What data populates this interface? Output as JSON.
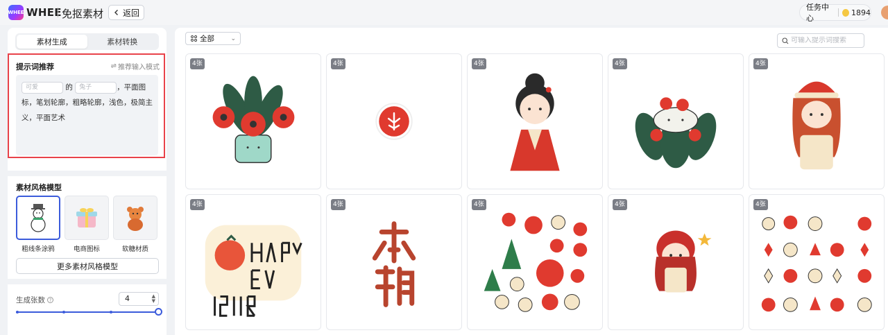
{
  "header": {
    "logo_text": "WHEE",
    "brand": "WHEE",
    "page_name": "免抠素材",
    "back_label": "返回",
    "task_center": "任务中心",
    "credits": "1894"
  },
  "sidebar": {
    "tabs": [
      {
        "label": "素材生成",
        "active": true
      },
      {
        "label": "素材转换",
        "active": false
      }
    ],
    "prompt": {
      "title": "提示词推荐",
      "switch_label": "推荐输入模式",
      "slot1_placeholder": "可爱",
      "connector": "的",
      "slot2_placeholder": "兔子",
      "text": "，平面图标，笔划轮廓，粗略轮廓，浅色，极简主义，平面艺术"
    },
    "styles": {
      "title": "素材风格模型",
      "items": [
        {
          "name": "粗线条涂鸦",
          "selected": true,
          "icon": "snowman-icon"
        },
        {
          "name": "电商图标",
          "selected": false,
          "icon": "gift-box-icon"
        },
        {
          "name": "软糖材质",
          "selected": false,
          "icon": "gummy-bear-icon"
        }
      ],
      "more_label": "更多素材风格模型"
    },
    "count": {
      "label": "生成张数",
      "value": "4"
    }
  },
  "main": {
    "filter_label": "全部",
    "search_placeholder": "可输入提示词搜索",
    "cells": [
      {
        "badge": "4张",
        "art": "flower-pot"
      },
      {
        "badge": "4张",
        "art": "red-circle-icon"
      },
      {
        "badge": "4张",
        "art": "hanfu-girl"
      },
      {
        "badge": "4张",
        "art": "rice-ball-leaves"
      },
      {
        "badge": "4张",
        "art": "christmas-girl"
      },
      {
        "badge": "4张",
        "art": "happy-new-year-text"
      },
      {
        "badge": "4张",
        "art": "calligraphy"
      },
      {
        "badge": "4张",
        "art": "christmas-stickers"
      },
      {
        "badge": "4张",
        "art": "red-dress-girl"
      },
      {
        "badge": "4张",
        "art": "ornament-pattern"
      }
    ]
  },
  "colors": {
    "accent": "#3b5bdb",
    "highlight_border": "#e8424a",
    "art_red": "#e03a2f",
    "art_green": "#2e5b45"
  }
}
